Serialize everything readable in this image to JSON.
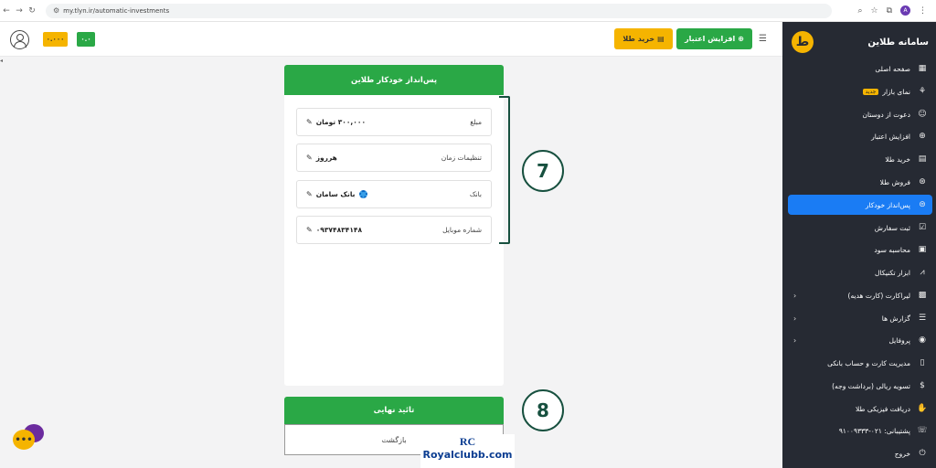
{
  "browser": {
    "url": "my.tlyn.ir/automatic-investments",
    "profile_initial": "A"
  },
  "topbar": {
    "balance_gold": "۰.۰۰۰",
    "balance_green": "۰.۰",
    "buy_gold_label": "خرید طلا",
    "increase_credit_label": "افزایش اعتبار"
  },
  "sidebar": {
    "title": "سامانه طلاین",
    "logo": "ط",
    "items": [
      {
        "label": "صفحه اصلی",
        "icon": "grid-icon"
      },
      {
        "label": "نمای بازار",
        "icon": "market-icon",
        "badge": "جدید"
      },
      {
        "label": "دعوت از دوستان",
        "icon": "users-icon"
      },
      {
        "label": "افزایش اعتبار",
        "icon": "plus-circle-icon"
      },
      {
        "label": "خرید طلا",
        "icon": "gold-bars-icon"
      },
      {
        "label": "فروش طلا",
        "icon": "money-bag-icon"
      },
      {
        "label": "پس‌انداز خودکار",
        "icon": "piggy-bank-icon",
        "active": true
      },
      {
        "label": "ثبت سفارش",
        "icon": "clipboard-icon"
      },
      {
        "label": "محاسبه سود",
        "icon": "calculator-icon"
      },
      {
        "label": "ابزار تکنیکال",
        "icon": "chart-icon"
      },
      {
        "label": "لیراکارت (کارت هدیه)",
        "icon": "gift-icon",
        "has_submenu": true
      },
      {
        "label": "گزارش ها",
        "icon": "report-icon",
        "has_submenu": true
      },
      {
        "label": "پروفایل",
        "icon": "profile-icon",
        "has_submenu": true
      },
      {
        "label": "مدیریت کارت و حساب بانکی",
        "icon": "bank-card-icon"
      },
      {
        "label": "تسویه ریالی (برداشت وجه)",
        "icon": "dollar-circle-icon"
      },
      {
        "label": "دریافت فیزیکی طلا",
        "icon": "hand-gold-icon"
      },
      {
        "label": "پشتیبانی: ۰۲۱-۹۱۰۰۹۳۳۳",
        "icon": "headset-icon"
      },
      {
        "label": "خروج",
        "icon": "power-icon"
      }
    ]
  },
  "card": {
    "title": "پس‌انداز خودکار طلاین",
    "rows": [
      {
        "label": "مبلغ",
        "value": "۳۰۰,۰۰۰ تومان"
      },
      {
        "label": "تنظیمات زمان",
        "value": "هرروز"
      },
      {
        "label": "بانک",
        "value": "بانک سامان"
      },
      {
        "label": "شماره موبایل",
        "value": "۰۹۳۷۴۸۳۴۱۴۸"
      }
    ]
  },
  "actions": {
    "confirm_label": "تائید نهایی",
    "back_label": "بازگشت"
  },
  "annotations": {
    "step_7": "7",
    "step_8": "8"
  },
  "watermark": {
    "logo": "RC",
    "text": "Royalclubb.com"
  },
  "colors": {
    "green": "#2aa846",
    "yellow": "#f5b400",
    "sidebar_bg": "#262a33",
    "active_blue": "#1a7cf4",
    "annotation": "#17503f"
  }
}
